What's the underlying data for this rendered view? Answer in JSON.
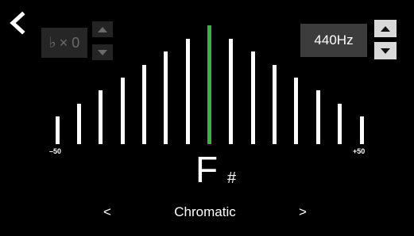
{
  "back_icon": "chevron-left-icon",
  "transpose": {
    "flat_symbol": "♭",
    "value": "× 0"
  },
  "reference": {
    "frequency": "440Hz"
  },
  "meter": {
    "scale_min": "–50",
    "scale_max": "+50",
    "bar_count": 15,
    "center_index": 7,
    "deviation_cents": 0,
    "accent_color": "#3cb43c"
  },
  "note": {
    "name": "F",
    "accidental": "#"
  },
  "mode": {
    "prev": "<",
    "label": "Chromatic",
    "next": ">"
  }
}
